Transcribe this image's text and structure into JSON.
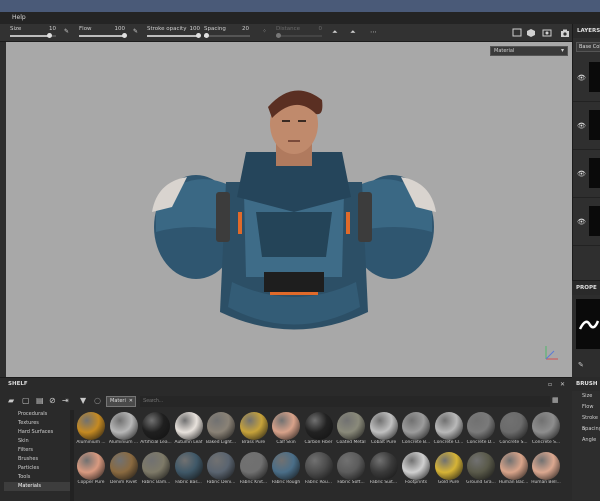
{
  "menu": {
    "help": "Help"
  },
  "toolbar": {
    "size_label": "Size",
    "size_value": "10",
    "size_fill": 0.85,
    "flow_label": "Flow",
    "flow_value": "100",
    "flow_fill": 1.0,
    "stroke_opacity_label": "Stroke opacity",
    "stroke_opacity_value": "100",
    "stroke_opacity_fill": 1.0,
    "spacing_label": "Spacing",
    "spacing_value": "20",
    "spacing_fill": 0.05,
    "distance_label": "Distance",
    "distance_value": "0"
  },
  "viewport": {
    "channel_dropdown": "Material"
  },
  "layers": {
    "title": "LAYERS",
    "base_color": "Base Col"
  },
  "properties": {
    "title": "PROPE"
  },
  "shelf": {
    "title": "SHELF",
    "search_tag": "Materi",
    "search_placeholder": "Search...",
    "categories": [
      "Procedurals",
      "Textures",
      "Hard Surfaces",
      "Skin",
      "Filters",
      "Brushes",
      "Particles",
      "Tools",
      "Materials"
    ],
    "active_category": "Materials",
    "row1": [
      {
        "label": "Aluminium ...",
        "color": "#c58a22"
      },
      {
        "label": "Aluminium ...",
        "color": "#b7b7b7"
      },
      {
        "label": "Artificial Lea...",
        "color": "#1f1f1f"
      },
      {
        "label": "Autumn Leaf",
        "color": "#e8e2dc"
      },
      {
        "label": "Baked Light...",
        "color": "#8a8276"
      },
      {
        "label": "Brass Pure",
        "color": "#c6a23a"
      },
      {
        "label": "Calf Skin",
        "color": "#d8a28a"
      },
      {
        "label": "Carbon Fiber",
        "color": "#222222"
      },
      {
        "label": "Coated Metal",
        "color": "#8a8a7a"
      },
      {
        "label": "Cobalt Pure",
        "color": "#c0c0c0"
      },
      {
        "label": "Concrete B...",
        "color": "#9c9c9c"
      },
      {
        "label": "Concrete Cl...",
        "color": "#b9b9b9"
      },
      {
        "label": "Concrete D...",
        "color": "#7a7a7a"
      },
      {
        "label": "Concrete S...",
        "color": "#6b6b6b"
      },
      {
        "label": "Concrete S...",
        "color": "#8e8e8e"
      }
    ],
    "row2": [
      {
        "label": "Copper Pure",
        "color": "#d99a80"
      },
      {
        "label": "Denim Rivet",
        "color": "#8a6a40"
      },
      {
        "label": "Fabric Bam...",
        "color": "#7e7a68"
      },
      {
        "label": "Fabric Bas...",
        "color": "#3f5868"
      },
      {
        "label": "Fabric Deni...",
        "color": "#5a6470"
      },
      {
        "label": "Fabric Knit...",
        "color": "#707070"
      },
      {
        "label": "Fabric Rough",
        "color": "#4a6e88"
      },
      {
        "label": "Fabric Rou...",
        "color": "#4c4c4c"
      },
      {
        "label": "Fabric Soft...",
        "color": "#5c5c5c"
      },
      {
        "label": "Fabric Suit...",
        "color": "#3a3a3a"
      },
      {
        "label": "Footprints",
        "color": "#d0d0d0"
      },
      {
        "label": "Gold Pure",
        "color": "#d6b436"
      },
      {
        "label": "Ground Gra...",
        "color": "#5a5a4a"
      },
      {
        "label": "Human Bac...",
        "color": "#d9a48a"
      },
      {
        "label": "Human Bell...",
        "color": "#dca890"
      }
    ]
  },
  "brush": {
    "title": "BRUSH",
    "rows": [
      "Size",
      "Flow",
      "Stroke o",
      "Spacing",
      "Angle"
    ]
  }
}
